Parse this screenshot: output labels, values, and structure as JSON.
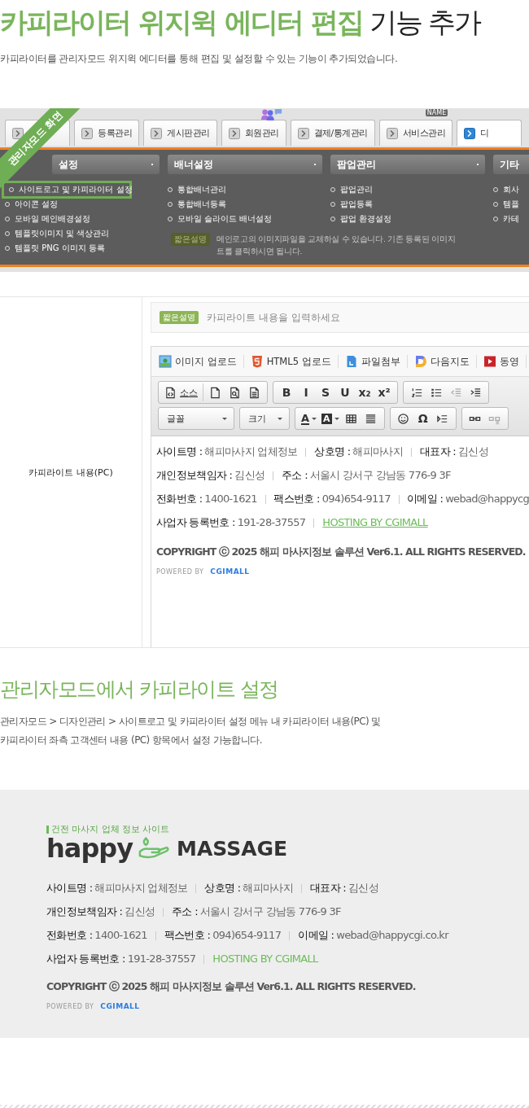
{
  "header": {
    "title_highlight": "카피라이터 위지윅 에디터 편집",
    "title_rest": "기능 추가",
    "description": "카피라이터를 관리자모드 위지윅 에디터를 통해 편집 및 설정할 수 있는 기능이 추가되었습니다."
  },
  "admin_screenshot": {
    "ribbon": "관리자모드 화면",
    "tabs": [
      {
        "selected": false,
        "kind": "plain"
      },
      {
        "label": "등록관리",
        "selected": false,
        "kind": "plain"
      },
      {
        "label": "게시판관리",
        "selected": false,
        "kind": "plain"
      },
      {
        "label": "회원관리",
        "selected": false,
        "kind": "people"
      },
      {
        "label": "결제/통계관리",
        "selected": false,
        "kind": "plain"
      },
      {
        "label": "서비스관리",
        "selected": false,
        "kind": "name-tag",
        "badge": "NAME"
      },
      {
        "label": "디",
        "selected": true,
        "kind": "plain"
      }
    ],
    "menus": [
      {
        "title": "설정",
        "items": [
          {
            "label": "사이트로고 및 카피라이터 설정",
            "highlighted": true
          },
          {
            "label": "아이콘 설정",
            "highlighted": false
          },
          {
            "label": "모바일 메인배경설정",
            "highlighted": false
          },
          {
            "label": "템플릿이미지 및 색상관리",
            "highlighted": false
          },
          {
            "label": "템플릿 PNG 이미지 등록",
            "highlighted": false
          }
        ]
      },
      {
        "title": "배너설정",
        "items": [
          {
            "label": "통합배너관리",
            "highlighted": false
          },
          {
            "label": "통합배너등록",
            "highlighted": false
          },
          {
            "label": "모바일 슬라이드 배너설정",
            "highlighted": false
          }
        ]
      },
      {
        "title": "팝업관리",
        "items": [
          {
            "label": "팝업관리",
            "highlighted": false
          },
          {
            "label": "팝업등록",
            "highlighted": false
          },
          {
            "label": "팝업 환경설정",
            "highlighted": false
          }
        ]
      },
      {
        "title": "기타",
        "items": [
          {
            "label": "회사",
            "highlighted": false
          },
          {
            "label": "템플",
            "highlighted": false
          },
          {
            "label": "카테",
            "highlighted": false
          }
        ]
      }
    ],
    "notice": {
      "badge": "짧은설명",
      "lines": [
        "메인로고의 이미지파일을 교체하실 수 있습니다. 기존 등록된 이미지",
        "트를 클릭하시면 됩니다."
      ]
    }
  },
  "editor_row": {
    "label": "카피라이트 내용(PC)",
    "hint_badge": "짧은설명",
    "placeholder": "카피라이트 내용을 입력하세요",
    "upload_buttons": [
      {
        "label": "이미지 업로드",
        "kind": "image"
      },
      {
        "label": "HTML5 업로드",
        "kind": "html5"
      },
      {
        "label": "파일첨부",
        "kind": "file"
      },
      {
        "label": "다음지도",
        "kind": "map"
      },
      {
        "label": "동영",
        "kind": "video"
      }
    ],
    "toolbar_rows": [
      [
        [
          {
            "kind": "source",
            "label": "소스"
          },
          {
            "kind": "page"
          },
          {
            "kind": "preview"
          },
          {
            "kind": "template"
          }
        ],
        [
          {
            "kind": "glyph",
            "label": "B"
          },
          {
            "kind": "glyph",
            "label": "I"
          },
          {
            "kind": "glyph",
            "label": "S"
          },
          {
            "kind": "glyph",
            "label": "U"
          },
          {
            "kind": "glyph",
            "label": "x₂"
          },
          {
            "kind": "glyph",
            "label": "x²"
          }
        ],
        [
          {
            "kind": "ol"
          },
          {
            "kind": "ul"
          },
          {
            "kind": "outdent"
          },
          {
            "kind": "indent"
          }
        ]
      ],
      [
        [
          {
            "kind": "dropdown",
            "label": "글꼴"
          }
        ],
        [
          {
            "kind": "dropdown",
            "label": "크기"
          }
        ],
        [
          {
            "kind": "color",
            "label": "A"
          },
          {
            "kind": "bgcolor",
            "label": "A"
          },
          {
            "kind": "table"
          },
          {
            "kind": "hr"
          }
        ],
        [
          {
            "kind": "smiley"
          },
          {
            "kind": "glyph",
            "label": "Ω"
          },
          {
            "kind": "quote"
          }
        ],
        [
          {
            "kind": "link"
          },
          {
            "kind": "unlink"
          }
        ]
      ]
    ],
    "content": {
      "rows": [
        [
          {
            "kind": "field",
            "label": "사이트명 :",
            "value": "해피마사지 업체정보"
          },
          {
            "kind": "field",
            "label": "상호명 :",
            "value": "해피마사지"
          },
          {
            "kind": "field",
            "label": "대표자 :",
            "value": "김신성"
          }
        ],
        [
          {
            "kind": "field",
            "label": "개인정보책임자 :",
            "value": "김신성"
          },
          {
            "kind": "field",
            "label": "주소 :",
            "value": "서울시 강서구 강남동 776-9 3F"
          }
        ],
        [
          {
            "kind": "field",
            "label": "전화번호 :",
            "value": "1400-1621"
          },
          {
            "kind": "field",
            "label": "팩스번호 :",
            "value": "094)654-9117"
          },
          {
            "kind": "field",
            "label": "이메일 :",
            "value": "webad@happycg"
          }
        ],
        [
          {
            "kind": "field",
            "label": "사업자 등록번호 :",
            "value": "191-28-37557"
          },
          {
            "kind": "link",
            "value": "HOSTING BY CGIMALL"
          }
        ]
      ],
      "copyright": "COPYRIGHT ⓒ 2025 해피 마사지정보 솔루션 Ver6.1. ALL RIGHTS RESERVED.",
      "powered": "POWERED BY",
      "powered_brand": "CGIMALL"
    }
  },
  "section": {
    "title": "관리자모드에서 카피라이트 설정",
    "lines": [
      "관리자모드 > 디자인관리 > 사이트로고 및 카피라이터 설정 메뉴 내 카피라이터 내용(PC) 및",
      "카피라이터 좌측 고객센터 내용 (PC) 항목에서 설정 가능합니다."
    ]
  },
  "footer": {
    "tagline": "건전 마사지 업체 정보 사이트",
    "brand": "happy",
    "brand_word": "MASSAGE",
    "rows": [
      [
        {
          "kind": "field",
          "label": "사이트명 :",
          "value": "해피마사지 업체정보"
        },
        {
          "kind": "field",
          "label": "상호명 :",
          "value": "해피마사지"
        },
        {
          "kind": "field",
          "label": "대표자 :",
          "value": "김신성"
        }
      ],
      [
        {
          "kind": "field",
          "label": "개인정보책임자 :",
          "value": "김신성"
        },
        {
          "kind": "field",
          "label": "주소 :",
          "value": "서울시 강서구 강남동 776-9 3F"
        }
      ],
      [
        {
          "kind": "field",
          "label": "전화번호 :",
          "value": "1400-1621"
        },
        {
          "kind": "field",
          "label": "팩스번호 :",
          "value": "094)654-9117"
        },
        {
          "kind": "field",
          "label": "이메일 :",
          "value": "webad@happycgi.co.kr"
        }
      ],
      [
        {
          "kind": "field",
          "label": "사업자 등록번호 :",
          "value": "191-28-37557"
        },
        {
          "kind": "link",
          "value": "HOSTING BY CGIMALL"
        }
      ]
    ],
    "copyright": "COPYRIGHT ⓒ 2025 해피 마사지정보 솔루션 Ver6.1. ALL RIGHTS RESERVED.",
    "powered": "POWERED BY",
    "powered_brand": "CGIMALL"
  }
}
